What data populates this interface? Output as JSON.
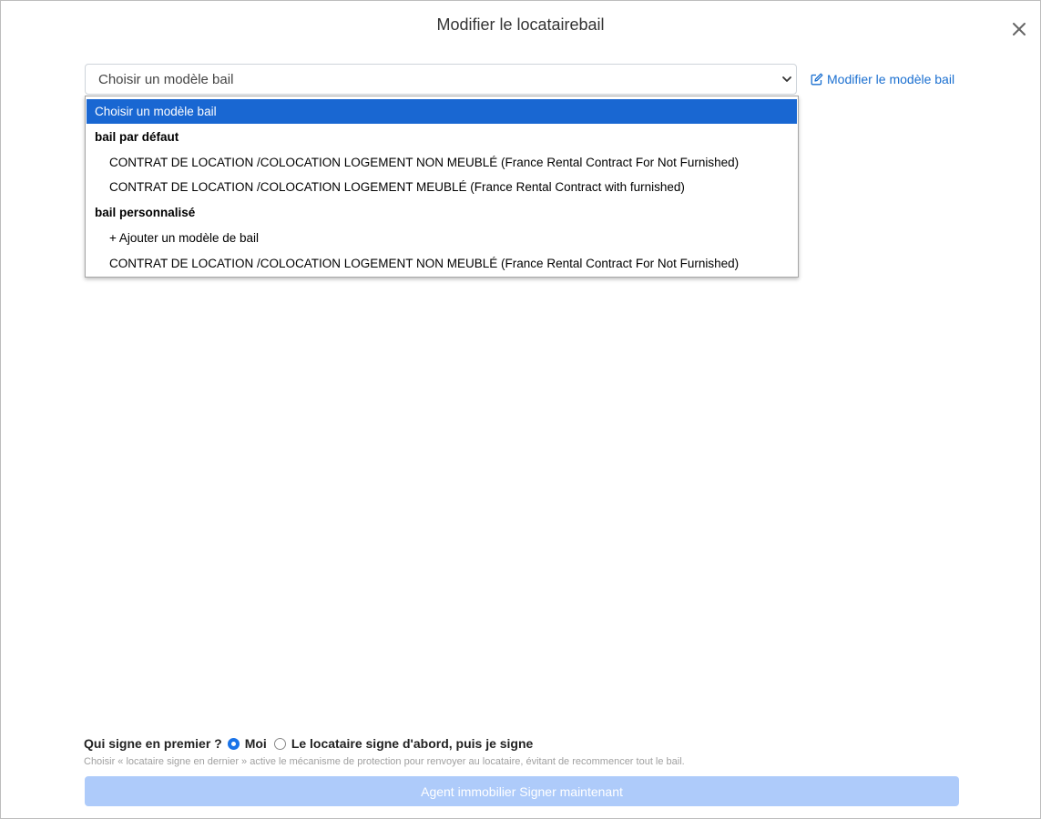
{
  "modal": {
    "title": "Modifier le locatairebail"
  },
  "template_select": {
    "value": "Choisir un modèle bail",
    "edit_link": "Modifier le modèle bail",
    "options": {
      "placeholder": "Choisir un modèle bail",
      "group_default": "bail par défaut",
      "default_1": "CONTRAT DE LOCATION /COLOCATION LOGEMENT NON MEUBLÉ (France Rental Contract For Not Furnished)",
      "default_2": "CONTRAT DE LOCATION /COLOCATION LOGEMENT MEUBLÉ (France Rental Contract with furnished)",
      "group_custom": "bail personnalisé",
      "add_template": "+ Ajouter un modèle de bail",
      "custom_1": "CONTRAT DE LOCATION /COLOCATION LOGEMENT NON MEUBLÉ (France Rental Contract For Not Furnished)"
    }
  },
  "signing": {
    "question": "Qui signe en premier ?",
    "option_me": "Moi",
    "option_tenant": "Le locataire signe d'abord, puis je signe",
    "help": "Choisir « locataire signe en dernier » active le mécanisme de protection pour renvoyer au locataire, évitant de recommencer tout le bail.",
    "selected": "Moi"
  },
  "actions": {
    "sign_now": "Agent immobilier Signer maintenant"
  },
  "colors": {
    "accent": "#1a73e8",
    "selected_option": "#1967d2",
    "link": "#1a6fd0",
    "disabled_button": "#aecbfa"
  }
}
